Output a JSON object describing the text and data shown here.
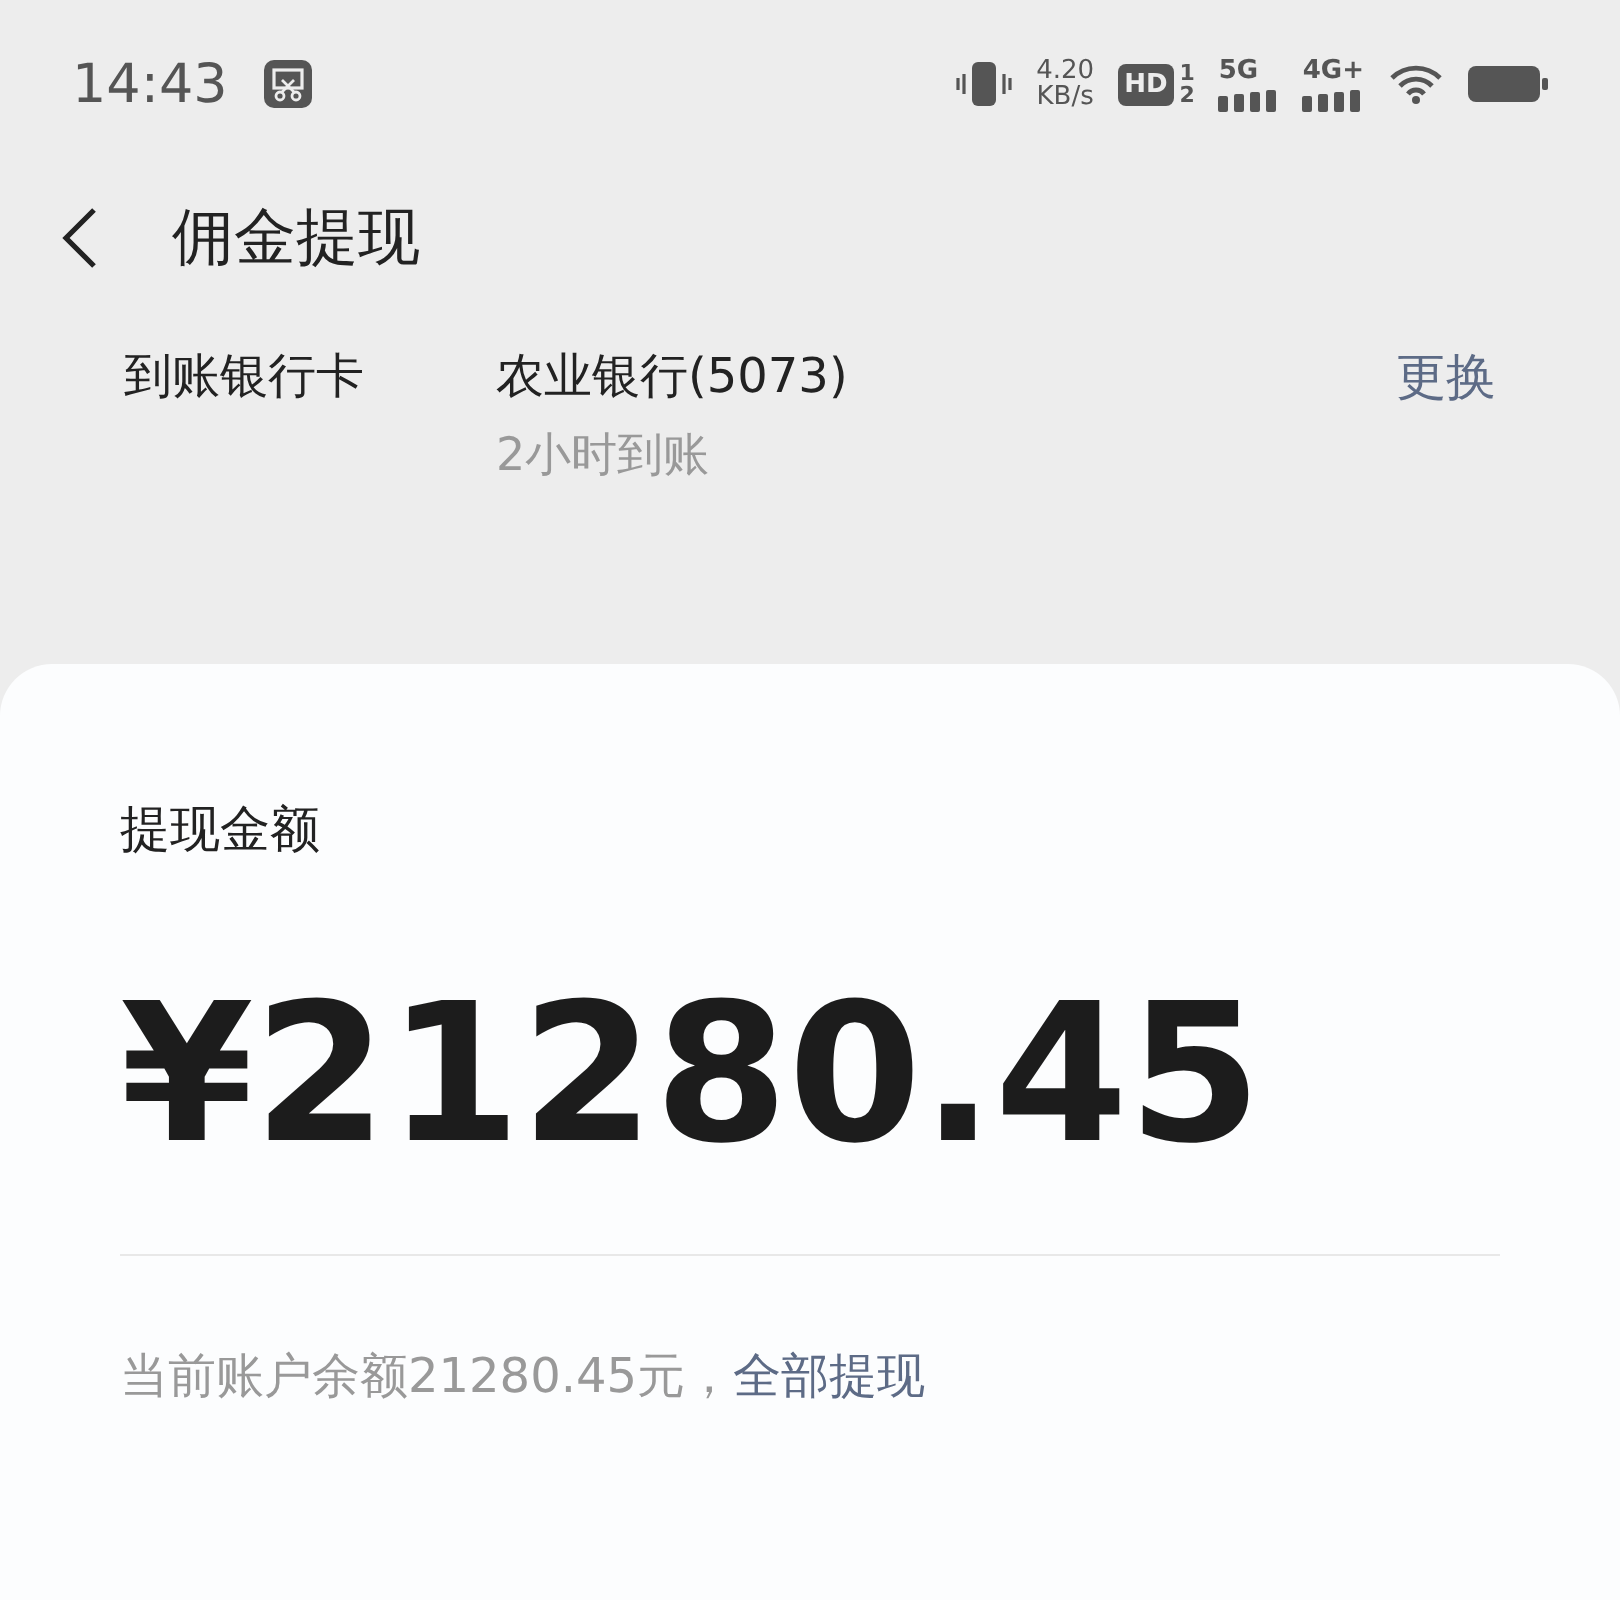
{
  "status_bar": {
    "time": "14:43",
    "net_speed": "4.20",
    "net_unit": "KB/s",
    "hd": "HD",
    "sims": [
      "1",
      "2"
    ],
    "networks": [
      {
        "label": "5G"
      },
      {
        "label": "4G+"
      }
    ]
  },
  "header": {
    "title": "佣金提现"
  },
  "bank": {
    "label": "到账银行卡",
    "name": "农业银行(5073)",
    "eta": "2小时到账",
    "action": "更换"
  },
  "withdraw": {
    "label": "提现金额",
    "amount": "¥21280.45",
    "balance": "当前账户余额21280.45元，",
    "all_link": "全部提现"
  }
}
